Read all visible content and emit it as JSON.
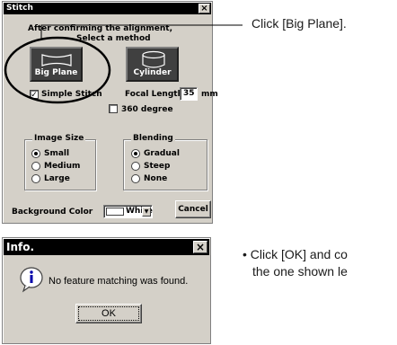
{
  "stitch": {
    "title": "Stitch",
    "close": "×",
    "instruction_line1": "After confirming the alignment,",
    "instruction_line2": "Select a method",
    "big_plane_label": "Big Plane",
    "cylinder_label": "Cylinder",
    "simple_stitch_label": "Simple Stitch",
    "simple_stitch_checked": true,
    "focal_length_label": "Focal Length",
    "focal_length_value": "35",
    "focal_length_unit": "mm",
    "degree_label": "360 degree",
    "image_size": {
      "title": "Image Size",
      "options": [
        "Small",
        "Medium",
        "Large"
      ],
      "selected": "Small"
    },
    "blending": {
      "title": "Blending",
      "options": [
        "Gradual",
        "Steep",
        "None"
      ],
      "selected": "Gradual"
    },
    "background_color_label": "Background Color",
    "background_color_value": "White",
    "cancel_label": "Cancel"
  },
  "info": {
    "title": "Info.",
    "close": "×",
    "message": "No feature matching was found.",
    "ok_label": "OK"
  },
  "callouts": {
    "top": "Click [Big Plane].",
    "bottom_line1": "• Click [OK] and co",
    "bottom_line2": "the one shown le"
  },
  "colors": {
    "window_bg": "#d4d0c8",
    "titlebar": "#000000",
    "method_button_bg": "#404040"
  }
}
